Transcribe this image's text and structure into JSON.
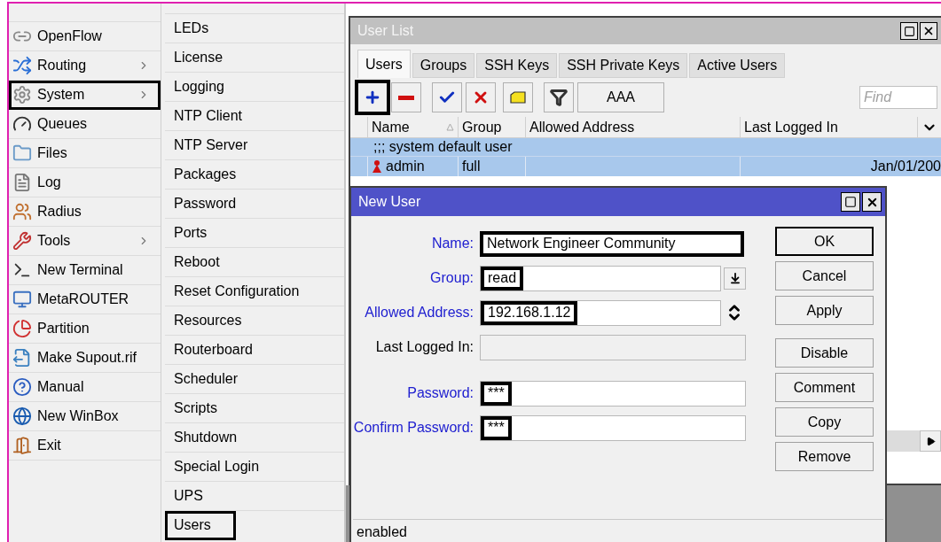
{
  "main_menu": [
    {
      "label": "OpenFlow",
      "submenu": false,
      "highlighted": false
    },
    {
      "label": "Routing",
      "submenu": true,
      "highlighted": false
    },
    {
      "label": "System",
      "submenu": true,
      "highlighted": true
    },
    {
      "label": "Queues",
      "submenu": false,
      "highlighted": false
    },
    {
      "label": "Files",
      "submenu": false,
      "highlighted": false
    },
    {
      "label": "Log",
      "submenu": false,
      "highlighted": false
    },
    {
      "label": "Radius",
      "submenu": false,
      "highlighted": false
    },
    {
      "label": "Tools",
      "submenu": true,
      "highlighted": false
    },
    {
      "label": "New Terminal",
      "submenu": false,
      "highlighted": false
    },
    {
      "label": "MetaROUTER",
      "submenu": false,
      "highlighted": false
    },
    {
      "label": "Partition",
      "submenu": false,
      "highlighted": false
    },
    {
      "label": "Make Supout.rif",
      "submenu": false,
      "highlighted": false
    },
    {
      "label": "Manual",
      "submenu": false,
      "highlighted": false
    },
    {
      "label": "New WinBox",
      "submenu": false,
      "highlighted": false
    },
    {
      "label": "Exit",
      "submenu": false,
      "highlighted": false
    }
  ],
  "system_menu": [
    {
      "label": "LEDs",
      "highlighted": false
    },
    {
      "label": "License",
      "highlighted": false
    },
    {
      "label": "Logging",
      "highlighted": false
    },
    {
      "label": "NTP Client",
      "highlighted": false
    },
    {
      "label": "NTP Server",
      "highlighted": false
    },
    {
      "label": "Packages",
      "highlighted": false
    },
    {
      "label": "Password",
      "highlighted": false
    },
    {
      "label": "Ports",
      "highlighted": false
    },
    {
      "label": "Reboot",
      "highlighted": false
    },
    {
      "label": "Reset Configuration",
      "highlighted": false
    },
    {
      "label": "Resources",
      "highlighted": false
    },
    {
      "label": "Routerboard",
      "highlighted": false
    },
    {
      "label": "Scheduler",
      "highlighted": false
    },
    {
      "label": "Scripts",
      "highlighted": false
    },
    {
      "label": "Shutdown",
      "highlighted": false
    },
    {
      "label": "Special Login",
      "highlighted": false
    },
    {
      "label": "UPS",
      "highlighted": false
    },
    {
      "label": "Users",
      "highlighted": true
    }
  ],
  "user_list": {
    "title": "User List",
    "tabs": [
      {
        "label": "Users",
        "selected": true
      },
      {
        "label": "Groups",
        "selected": false
      },
      {
        "label": "SSH Keys",
        "selected": false
      },
      {
        "label": "SSH Private Keys",
        "selected": false
      },
      {
        "label": "Active Users",
        "selected": false
      }
    ],
    "toolbar": [
      {
        "kind": "add",
        "highlighted": true
      },
      {
        "kind": "remove",
        "highlighted": false
      },
      {
        "kind": "enable",
        "highlighted": false
      },
      {
        "kind": "disable",
        "highlighted": false
      },
      {
        "kind": "comment",
        "highlighted": false
      },
      {
        "kind": "filter",
        "highlighted": false
      },
      {
        "kind": "text",
        "label": "AAA",
        "highlighted": false
      }
    ],
    "search": {
      "placeholder": "Find"
    },
    "columns": [
      "Name",
      "Group",
      "Allowed Address",
      "Last Logged In"
    ],
    "rows": [
      {
        "comment": ";;; system default user",
        "name": "admin",
        "group": "full",
        "last_logged_in": "Jan/01/200",
        "selected": true
      }
    ]
  },
  "new_user": {
    "title": "New User",
    "fields": [
      {
        "label": "Name:",
        "kind": "text",
        "value": "Network Engineer Community",
        "highlighted": true,
        "disabled": false
      },
      {
        "label": "Group:",
        "kind": "combo",
        "value": "read",
        "highlighted": true,
        "disabled": false
      },
      {
        "label": "Allowed Address:",
        "kind": "address",
        "value": "192.168.1.12",
        "highlighted": true,
        "disabled": false
      },
      {
        "label": "Last Logged In:",
        "kind": "readonly",
        "highlighted": false,
        "disabled": true
      },
      {
        "label": "Password:",
        "kind": "password",
        "value": "***",
        "highlighted": true,
        "disabled": false
      },
      {
        "label": "Confirm Password:",
        "kind": "password",
        "value": "***",
        "highlighted": true,
        "disabled": false
      }
    ],
    "buttons": [
      "OK",
      "Cancel",
      "Apply",
      "Disable",
      "Comment",
      "Copy",
      "Remove"
    ],
    "status": "enabled"
  }
}
